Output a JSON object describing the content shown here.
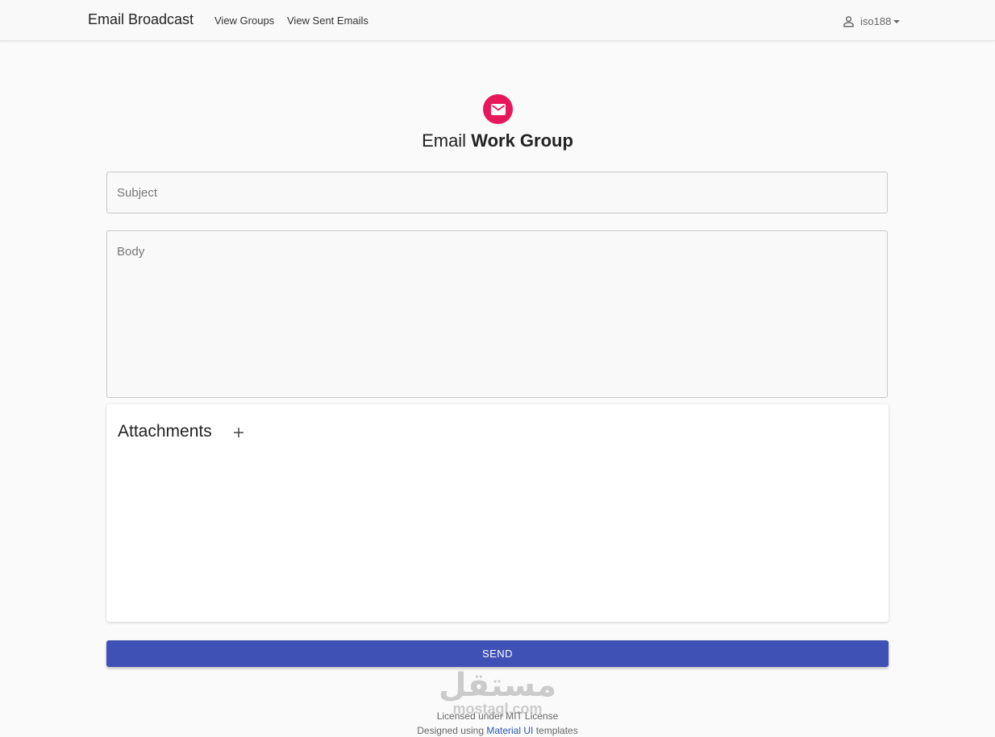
{
  "header": {
    "brand": "Email Broadcast",
    "nav": [
      {
        "label": "View Groups"
      },
      {
        "label": "View Sent Emails"
      }
    ],
    "user": {
      "name": "iso188",
      "icon": "person-icon"
    }
  },
  "main": {
    "icon": "email-icon",
    "title_prefix": "Email",
    "title_bold": "Work Group",
    "subject_placeholder": "Subject",
    "body_placeholder": "Body",
    "attachments_title": "Attachments",
    "add_icon": "plus-icon",
    "send_label": "SEND"
  },
  "watermark": {
    "arabic": "مستقل",
    "latin": "mostaql.com"
  },
  "footer": {
    "license": "Licensed under MIT License",
    "designed_prefix": "Designed using",
    "designed_link": "Material UI",
    "designed_suffix": "templates"
  },
  "colors": {
    "accent": "#e8175c",
    "primary_button": "#3f51b5",
    "link": "#2a56b8"
  }
}
